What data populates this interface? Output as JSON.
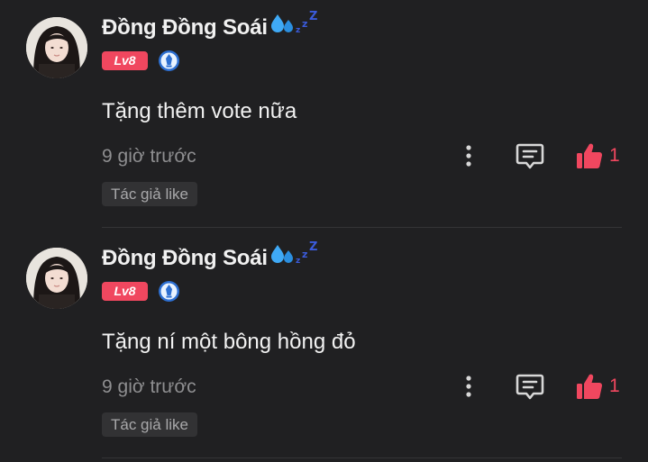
{
  "comments": [
    {
      "username": "Đồng Đồng Soái",
      "level_badge": "Lv8",
      "text": "Tặng thêm vote nữa",
      "timestamp": "9 giờ trước",
      "like_count": "1",
      "author_like_tag": "Tác giả like"
    },
    {
      "username": "Đồng Đồng Soái",
      "level_badge": "Lv8",
      "text": "Tặng ní một bông hồng đỏ",
      "timestamp": "9 giờ trước",
      "like_count": "1",
      "author_like_tag": "Tác giả like"
    }
  ],
  "icons": {
    "username_emoji": "sleeping-sweat-icon",
    "badge": "medal-icon",
    "more": "more-vertical-icon",
    "reply": "reply-icon",
    "like": "thumbs-up-icon"
  },
  "colors": {
    "background": "#202022",
    "accent": "#f0475f",
    "muted_text": "#8e8e90",
    "tag_background": "#323234"
  }
}
